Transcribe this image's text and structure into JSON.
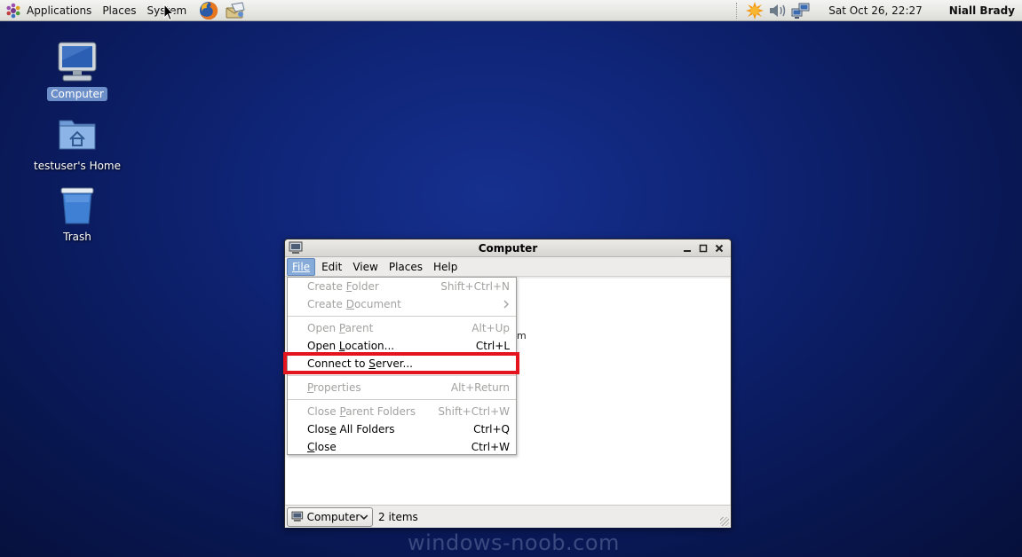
{
  "panel": {
    "menus": [
      "Applications",
      "Places",
      "System"
    ],
    "clock": "Sat Oct 26, 22:27",
    "user": "Niall Brady"
  },
  "desktop": {
    "icons": [
      {
        "label": "Computer",
        "icon": "computer-icon",
        "selected": true
      },
      {
        "label": "testuser's Home",
        "icon": "home-folder-icon",
        "selected": false
      },
      {
        "label": "Trash",
        "icon": "trash-icon",
        "selected": false
      }
    ]
  },
  "window": {
    "title": "Computer",
    "menus": [
      "File",
      "Edit",
      "View",
      "Places",
      "Help"
    ],
    "active_menu": "File",
    "ghost_text": "m",
    "status": {
      "location_label": "Computer",
      "items_count": "2 items"
    }
  },
  "file_menu": {
    "items": [
      {
        "pre": "Create ",
        "ul": "F",
        "post": "older",
        "accel": "Shift+Ctrl+N",
        "disabled": true
      },
      {
        "pre": "Create ",
        "ul": "D",
        "post": "ocument",
        "accel": "",
        "disabled": true,
        "submenu": true
      },
      {
        "separator": true
      },
      {
        "pre": "Open ",
        "ul": "P",
        "post": "arent",
        "accel": "Alt+Up",
        "disabled": true
      },
      {
        "pre": "Open ",
        "ul": "L",
        "post": "ocation...",
        "accel": "Ctrl+L",
        "disabled": false
      },
      {
        "pre": "Connect to ",
        "ul": "S",
        "post": "erver...",
        "accel": "",
        "disabled": false,
        "highlighted": true
      },
      {
        "separator": true
      },
      {
        "pre": "",
        "ul": "P",
        "post": "roperties",
        "accel": "Alt+Return",
        "disabled": true
      },
      {
        "separator": true
      },
      {
        "pre": "Close ",
        "ul": "P",
        "post": "arent Folders",
        "accel": "Shift+Ctrl+W",
        "disabled": true
      },
      {
        "pre": "Clos",
        "ul": "e",
        "post": " All Folders",
        "accel": "Ctrl+Q",
        "disabled": false
      },
      {
        "pre": "",
        "ul": "C",
        "post": "lose",
        "accel": "Ctrl+W",
        "disabled": false
      }
    ]
  },
  "watermark": "windows-noob.com",
  "colors": {
    "highlight_box": "#e3141e",
    "menu_active": "#86abd9",
    "desktop_bg": "#0f2578"
  }
}
